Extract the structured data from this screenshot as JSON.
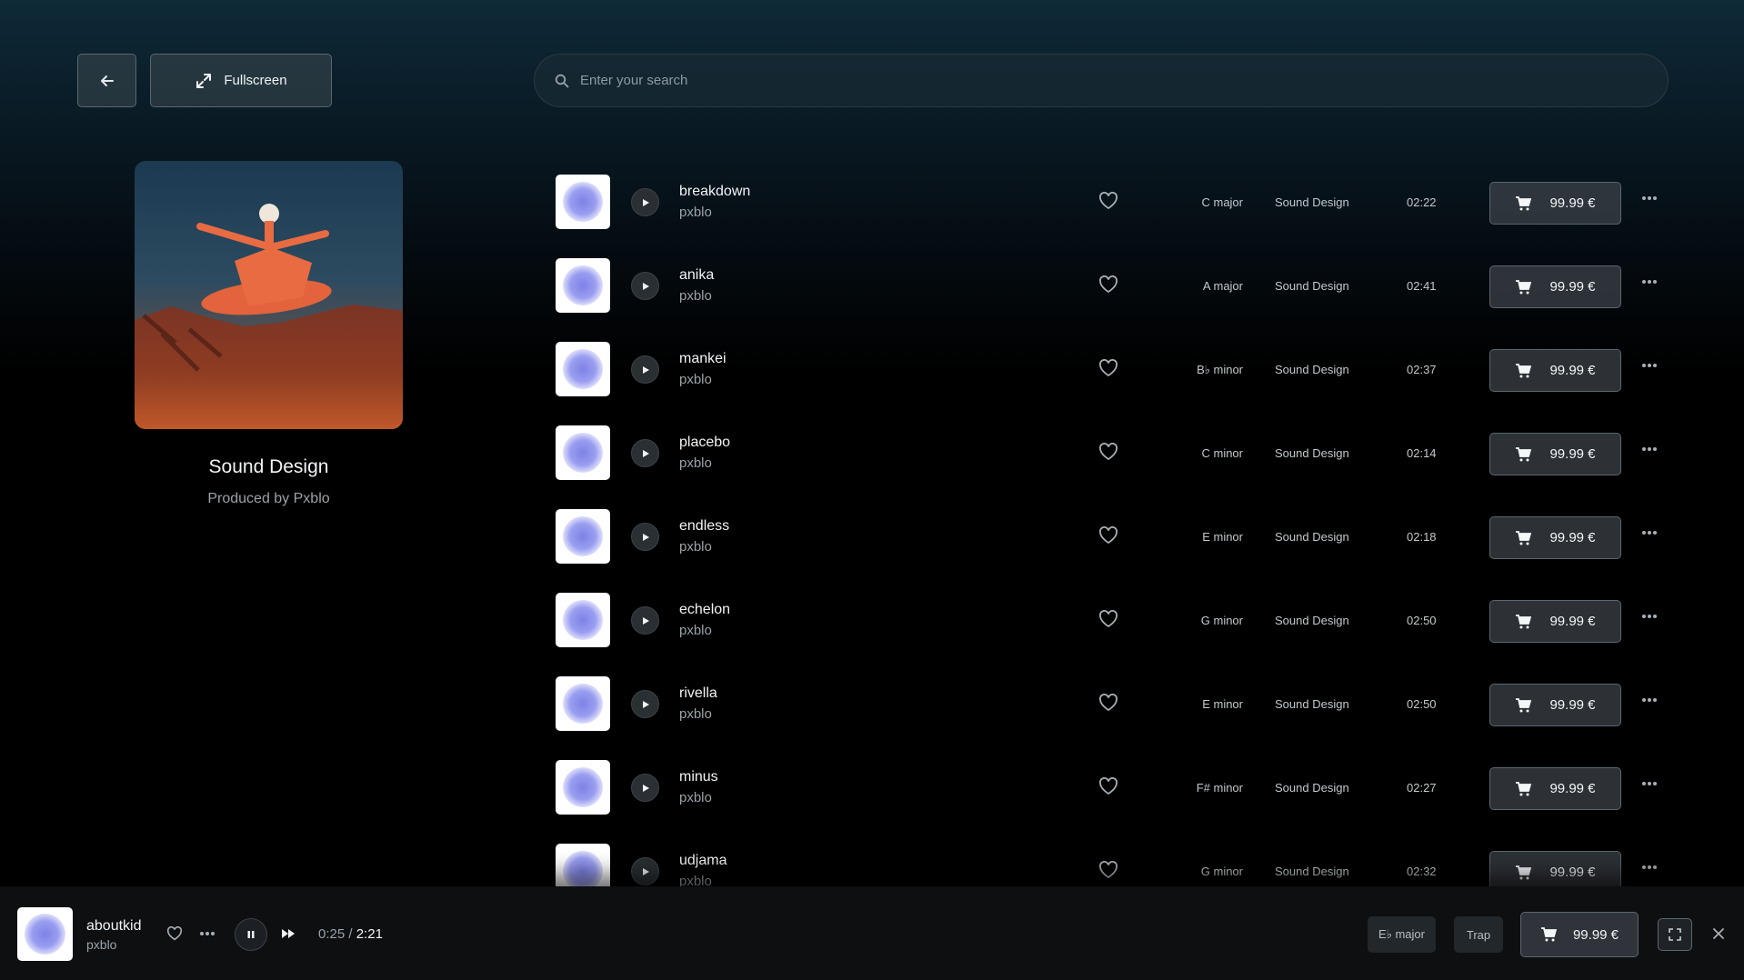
{
  "header": {
    "back_icon": "arrow-left-icon",
    "fullscreen_label": "Fullscreen",
    "search_placeholder": "Enter your search"
  },
  "album": {
    "title": "Sound Design",
    "subtitle": "Produced by Pxblo"
  },
  "tracks": [
    {
      "name": "breakdown",
      "artist": "pxblo",
      "key": "C major",
      "genre": "Sound Design",
      "duration": "02:22",
      "price": "99.99 €"
    },
    {
      "name": "anika",
      "artist": "pxblo",
      "key": "A major",
      "genre": "Sound Design",
      "duration": "02:41",
      "price": "99.99 €"
    },
    {
      "name": "mankei",
      "artist": "pxblo",
      "key": "B♭ minor",
      "genre": "Sound Design",
      "duration": "02:37",
      "price": "99.99 €"
    },
    {
      "name": "placebo",
      "artist": "pxblo",
      "key": "C minor",
      "genre": "Sound Design",
      "duration": "02:14",
      "price": "99.99 €"
    },
    {
      "name": "endless",
      "artist": "pxblo",
      "key": "E minor",
      "genre": "Sound Design",
      "duration": "02:18",
      "price": "99.99 €"
    },
    {
      "name": "echelon",
      "artist": "pxblo",
      "key": "G minor",
      "genre": "Sound Design",
      "duration": "02:50",
      "price": "99.99 €"
    },
    {
      "name": "rivella",
      "artist": "pxblo",
      "key": "E minor",
      "genre": "Sound Design",
      "duration": "02:50",
      "price": "99.99 €"
    },
    {
      "name": "minus",
      "artist": "pxblo",
      "key": "F# minor",
      "genre": "Sound Design",
      "duration": "02:27",
      "price": "99.99 €"
    },
    {
      "name": "udjama",
      "artist": "pxblo",
      "key": "G minor",
      "genre": "Sound Design",
      "duration": "02:32",
      "price": "99.99 €"
    }
  ],
  "player": {
    "track_name": "aboutkid",
    "artist": "pxblo",
    "current_time": "0:25",
    "separator": " / ",
    "total_time": "2:21",
    "key": "E♭ major",
    "genre": "Trap",
    "price": "99.99 €"
  },
  "colors": {
    "background_top": "#0f2a38",
    "background_bottom": "#000000",
    "thumb_blob": "#7d82e6"
  }
}
